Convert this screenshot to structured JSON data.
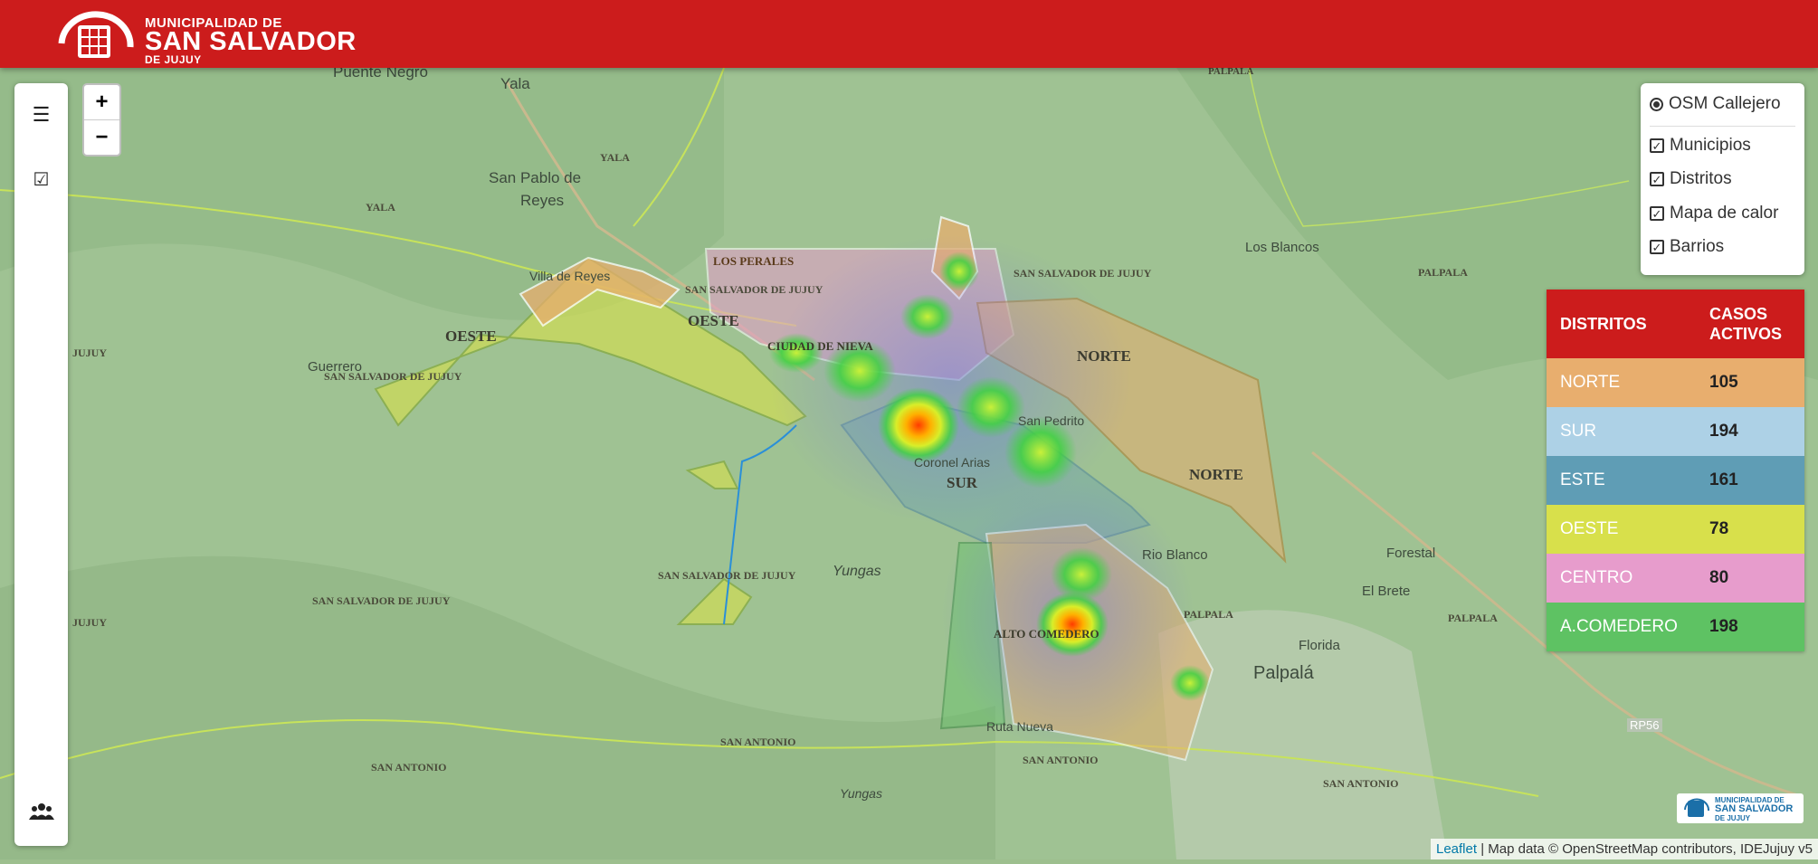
{
  "header": {
    "brand_line1": "MUNICIPALIDAD DE",
    "brand_line2": "SAN SALVADOR",
    "brand_line3": "DE JUJUY"
  },
  "sidebar": {
    "items": [
      {
        "icon": "menu-icon"
      },
      {
        "icon": "checklist-icon"
      },
      {
        "icon": "users-icon"
      }
    ]
  },
  "zoom": {
    "in_label": "+",
    "out_label": "−"
  },
  "layers": {
    "base": "OSM Callejero",
    "overlays": [
      "Municipios",
      "Distritos",
      "Mapa de calor",
      "Barrios"
    ]
  },
  "legend": {
    "header_distritos": "DISTRITOS",
    "header_casos": "CASOS ACTIVOS",
    "rows": [
      {
        "name": "NORTE",
        "value": "105",
        "color": "#e8ae6e"
      },
      {
        "name": "SUR",
        "value": "194",
        "color": "#add1e6"
      },
      {
        "name": "ESTE",
        "value": "161",
        "color": "#5f9db5"
      },
      {
        "name": "OESTE",
        "value": "78",
        "color": "#d8e04b"
      },
      {
        "name": "CENTRO",
        "value": "80",
        "color": "#e79ccc"
      },
      {
        "name": "A.COMEDERO",
        "value": "198",
        "color": "#5ec263"
      }
    ]
  },
  "map": {
    "place_labels": [
      "Puente Negro",
      "Yala",
      "San Pablo de",
      "Reyes",
      "Los Blancos",
      "Guerrero",
      "Rio Blanco",
      "Forestal",
      "El Brete",
      "Florida",
      "Palpalá",
      "Yungas",
      "Yungas",
      "RP56",
      "San Pedrito",
      "Coronel Arias",
      "Villa de Reyes",
      "Ruta Nueva"
    ],
    "admin_labels": [
      "PALPALA",
      "YALA",
      "YALA",
      "SAN SALVADOR DE JUJUY",
      "PALPALA",
      "SAN SALVADOR DE JUJUY",
      "SAN SALVADOR DE JUJUY",
      "SAN SALVADOR DE JUJUY",
      "SAN SALVADOR DE JUJUY",
      "PALPALA",
      "PALPALA",
      "SAN ANTONIO",
      "SAN ANTONIO",
      "SAN ANTONIO",
      "SAN ANTONIO",
      "JUJUY",
      "JUJUY"
    ],
    "district_labels": [
      "OESTE",
      "OESTE",
      "NORTE",
      "NORTE",
      "SUR",
      "LOS PERALES",
      "CIUDAD DE NIEVA",
      "ALTO COMEDERO"
    ]
  },
  "watermark": {
    "line1": "MUNICIPALIDAD DE",
    "line2": "SAN SALVADOR",
    "line3": "DE JUJUY"
  },
  "attribution": {
    "link": "Leaflet",
    "text": " | Map data © OpenStreetMap contributors, IDEJujuy v5"
  }
}
